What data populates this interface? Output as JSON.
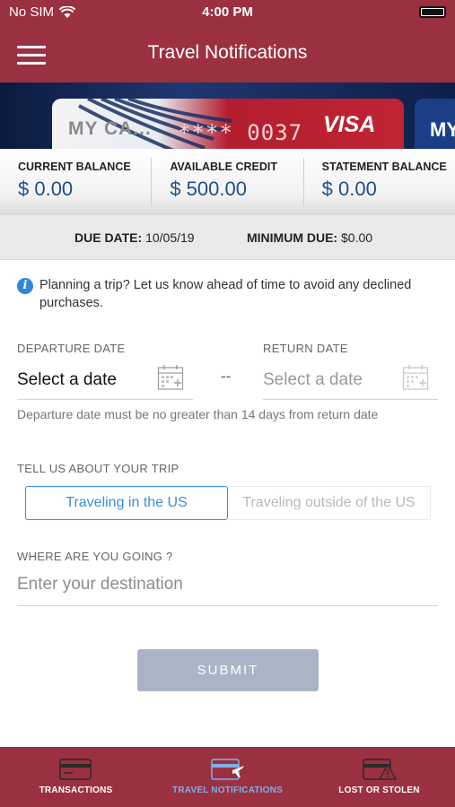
{
  "status_bar": {
    "carrier": "No SIM",
    "time": "4:00 PM"
  },
  "header": {
    "title": "Travel Notifications"
  },
  "card": {
    "name": "MY CA...",
    "number_masked": "**** 0037",
    "brand": "VISA",
    "next_card_label": "MY"
  },
  "balances": [
    {
      "label": "CURRENT BALANCE",
      "value": "$ 0.00"
    },
    {
      "label": "AVAILABLE CREDIT",
      "value": "$ 500.00"
    },
    {
      "label": "STATEMENT BALANCE",
      "value": "$ 0.00"
    }
  ],
  "due": {
    "due_date_label": "DUE DATE:",
    "due_date_value": "10/05/19",
    "minimum_due_label": "MINIMUM DUE:",
    "minimum_due_value": "$0.00"
  },
  "form": {
    "info_text": "Planning a trip? Let us know ahead of time to avoid any declined purchases.",
    "departure_label": "DEPARTURE DATE",
    "departure_value": "Select a date",
    "separator": "--",
    "return_label": "RETURN DATE",
    "return_value": "Select a date",
    "date_hint": "Departure date must be no greater than 14 days from return date",
    "trip_label": "TELL US ABOUT YOUR TRIP",
    "trip_options": [
      "Traveling in the US",
      "Traveling outside of the US"
    ],
    "trip_selected": "Traveling in the US",
    "destination_label": "WHERE ARE YOU GOING ?",
    "destination_placeholder": "Enter your destination",
    "submit_label": "SUBMIT"
  },
  "bottom_nav": [
    {
      "label": "TRANSACTIONS",
      "icon": "card-list-icon",
      "active": false
    },
    {
      "label": "TRAVEL NOTIFICATIONS",
      "icon": "card-plane-icon",
      "active": true
    },
    {
      "label": "LOST OR STOLEN",
      "icon": "card-warning-icon",
      "active": false
    }
  ],
  "colors": {
    "brand": "#9b3140",
    "accent": "#3a8ed6",
    "value_text": "#1e4f88",
    "submit_disabled": "#a9b5c6",
    "nav_active": "#7db0ea"
  }
}
